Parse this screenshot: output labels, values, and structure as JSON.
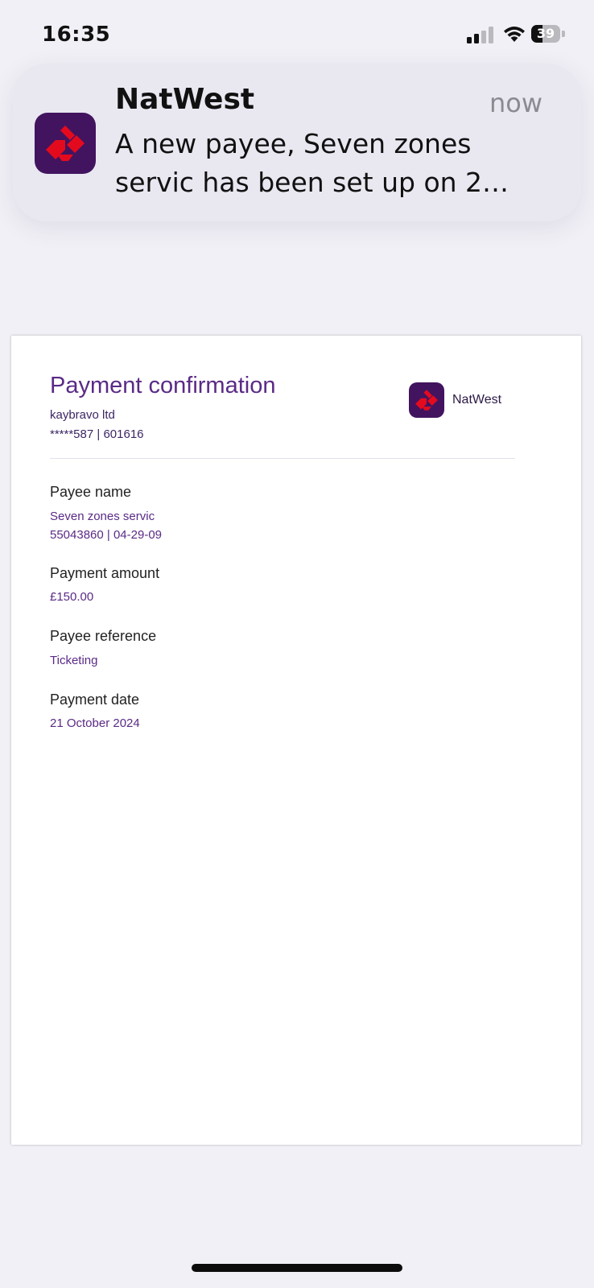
{
  "status_bar": {
    "time": "16:35",
    "battery_percent": 39,
    "battery_label": "39",
    "signal_bars_active": 2,
    "signal_bars_total": 4
  },
  "notification": {
    "app_name": "NatWest",
    "time": "now",
    "body_line1": "A new payee, Seven zones",
    "body_line2": "servic has been set up on 2…",
    "icon": "natwest-logo-icon"
  },
  "document": {
    "title": "Payment confirmation",
    "company": "kaybravo ltd",
    "account": "*****587  |  601616",
    "brand": "NatWest",
    "fields": [
      {
        "label": "Payee name",
        "values": [
          "Seven zones servic",
          "55043860 | 04-29-09"
        ]
      },
      {
        "label": "Payment amount",
        "values": [
          "£150.00"
        ]
      },
      {
        "label": "Payee reference",
        "values": [
          "Ticketing"
        ]
      },
      {
        "label": "Payment date",
        "values": [
          "21 October 2024"
        ]
      }
    ]
  },
  "colors": {
    "background": "#f1f0f6",
    "brand_purple": "#42145f",
    "brand_red": "#e40a1e",
    "accent_text": "#5a2a86"
  }
}
